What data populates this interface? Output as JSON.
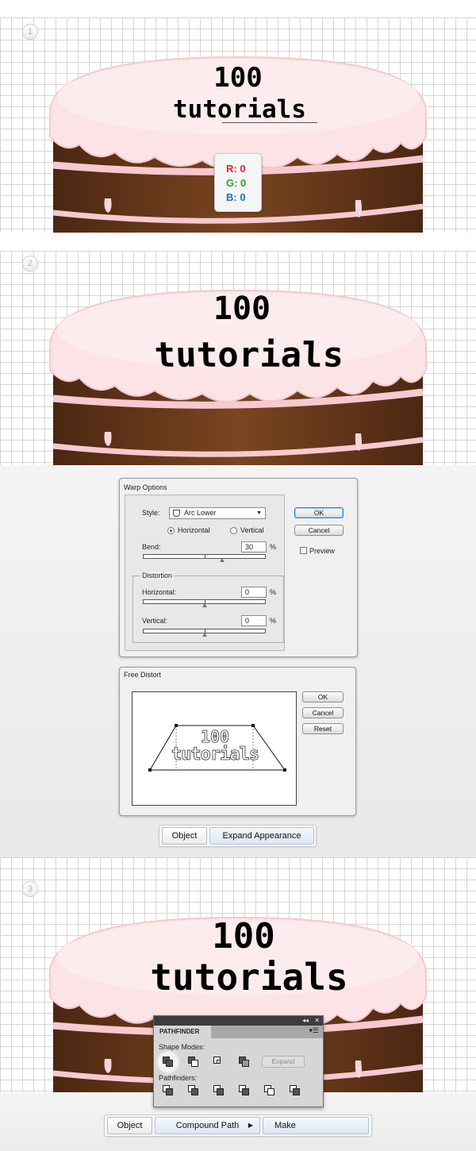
{
  "steps": [
    "1",
    "2",
    "3"
  ],
  "cake": {
    "line1": "100",
    "line2": "tutorials",
    "colors": {
      "frosting": "#fce4e6",
      "frosting_edge": "#f7cdd2",
      "chocolate": "#6a3a1c",
      "chocolate_dark": "#4b2712",
      "cream_stripe": "#f7c9d0"
    }
  },
  "rgb_tooltip": {
    "r": "R: 0",
    "g": "G: 0",
    "b": "B: 0",
    "r_color": "#e0282e",
    "g_color": "#2aa142",
    "b_color": "#1f73c4"
  },
  "warp_options": {
    "title": "Warp Options",
    "style_label": "Style:",
    "style_value": "Arc Lower",
    "horizontal_label": "Horizontal",
    "vertical_label": "Vertical",
    "orientation_selected": "Horizontal",
    "bend_label": "Bend:",
    "bend_value": "30",
    "percent": "%",
    "distortion_label": "Distortion",
    "dist_horizontal_label": "Horizontal:",
    "dist_horizontal_value": "0",
    "dist_vertical_label": "Vertical:",
    "dist_vertical_value": "0",
    "ok_label": "OK",
    "cancel_label": "Cancel",
    "preview_label": "Preview",
    "preview_checked": false
  },
  "free_distort": {
    "title": "Free Distort",
    "ok_label": "OK",
    "cancel_label": "Cancel",
    "reset_label": "Reset",
    "preview_line1": "100",
    "preview_line2": "tutorials"
  },
  "menu_bar_1": {
    "object": "Object",
    "command": "Expand Appearance"
  },
  "pathfinder": {
    "tab": "PATHFINDER",
    "shape_modes_label": "Shape Modes:",
    "expand_label": "Expand",
    "pathfinders_label": "Pathfinders:",
    "collapse_glyph": "◂◂",
    "close_glyph": "✕",
    "menu_glyph": "▾☰"
  },
  "menu_bar_2": {
    "object": "Object",
    "submenu": "Compound Path",
    "command": "Make"
  }
}
